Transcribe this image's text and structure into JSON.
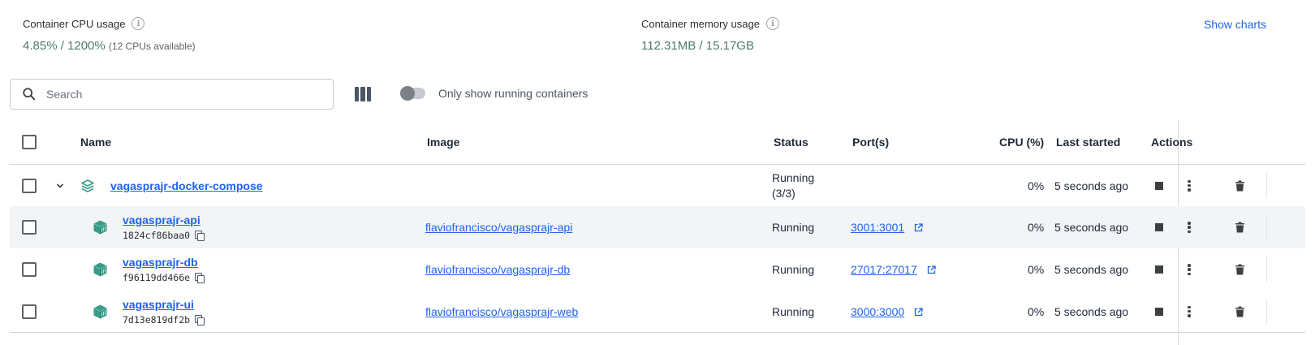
{
  "stats": {
    "cpu_label": "Container CPU usage",
    "cpu_value": "4.85% / 1200%",
    "cpu_sub": "(12 CPUs available)",
    "memory_label": "Container memory usage",
    "memory_value": "112.31MB / 15.17GB",
    "show_charts": "Show charts"
  },
  "toolbar": {
    "search_placeholder": "Search",
    "toggle_label": "Only show running containers",
    "toggle_on": false
  },
  "table": {
    "headers": {
      "name": "Name",
      "image": "Image",
      "status": "Status",
      "ports": "Port(s)",
      "cpu": "CPU (%)",
      "last_started": "Last started",
      "actions": "Actions"
    },
    "group": {
      "name": "vagasprajr-docker-compose",
      "status_line1": "Running",
      "status_line2": "(3/3)",
      "cpu": "0%",
      "last_started": "5 seconds ago"
    },
    "rows": [
      {
        "name": "vagasprajr-api",
        "id": "1824cf86baa0",
        "image": "flaviofrancisco/vagasprajr-api",
        "status": "Running",
        "port": "3001:3001",
        "cpu": "0%",
        "last_started": "5 seconds ago"
      },
      {
        "name": "vagasprajr-db",
        "id": "f96119dd466e",
        "image": "flaviofrancisco/vagasprajr-db",
        "status": "Running",
        "port": "27017:27017",
        "cpu": "0%",
        "last_started": "5 seconds ago"
      },
      {
        "name": "vagasprajr-ui",
        "id": "7d13e819df2b",
        "image": "flaviofrancisco/vagasprajr-web",
        "status": "Running",
        "port": "3000:3000",
        "cpu": "0%",
        "last_started": "5 seconds ago"
      }
    ]
  },
  "colors": {
    "accent": "#1d63ed",
    "stat_value": "#4f7a6e",
    "container_icon": "#3a9b87"
  },
  "icons": [
    "info-icon",
    "search-icon",
    "columns-icon",
    "stack-icon",
    "container-icon",
    "copy-icon",
    "external-link-icon",
    "stop-icon",
    "more-icon",
    "trash-icon",
    "chevron-down-icon"
  ]
}
